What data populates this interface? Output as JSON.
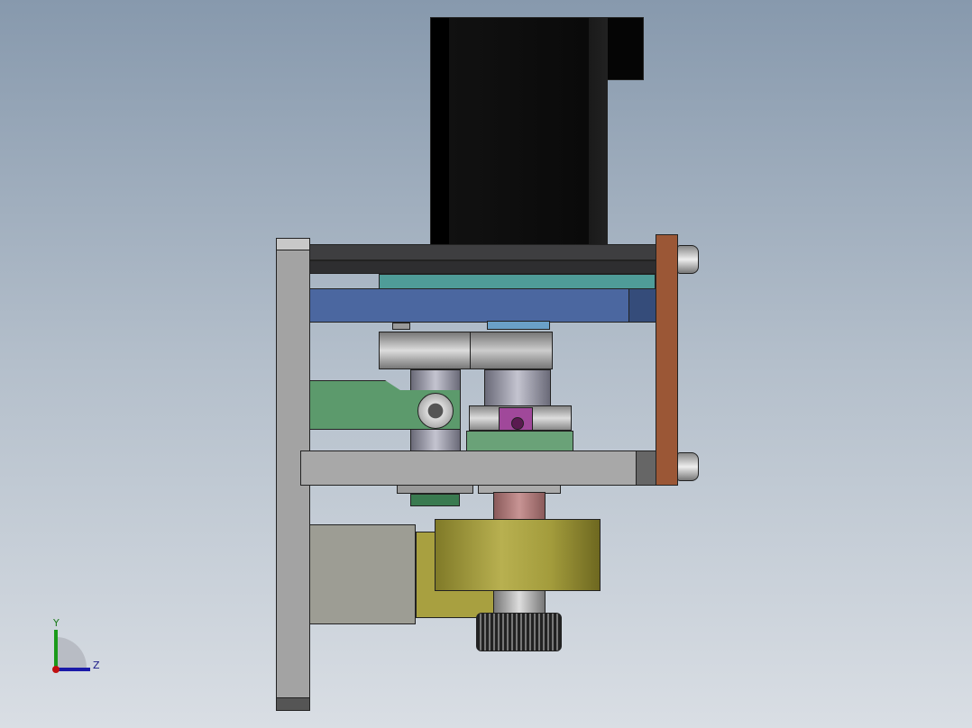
{
  "viewport": {
    "model": "assembly",
    "colors": {
      "motor": "#050505",
      "frame": "#a3a3a3",
      "top_plate": "#3e3e40",
      "teal_plate": "#4f9c98",
      "blue_plate": "#4b67a0",
      "side_plate": "#9b5736",
      "lever": "#5c9a6c",
      "drum": "#a39c3c",
      "roller": "#b07a7a",
      "bracket": "#9d9d94"
    }
  },
  "triad": {
    "y_label": "Y",
    "z_label": "Z"
  }
}
